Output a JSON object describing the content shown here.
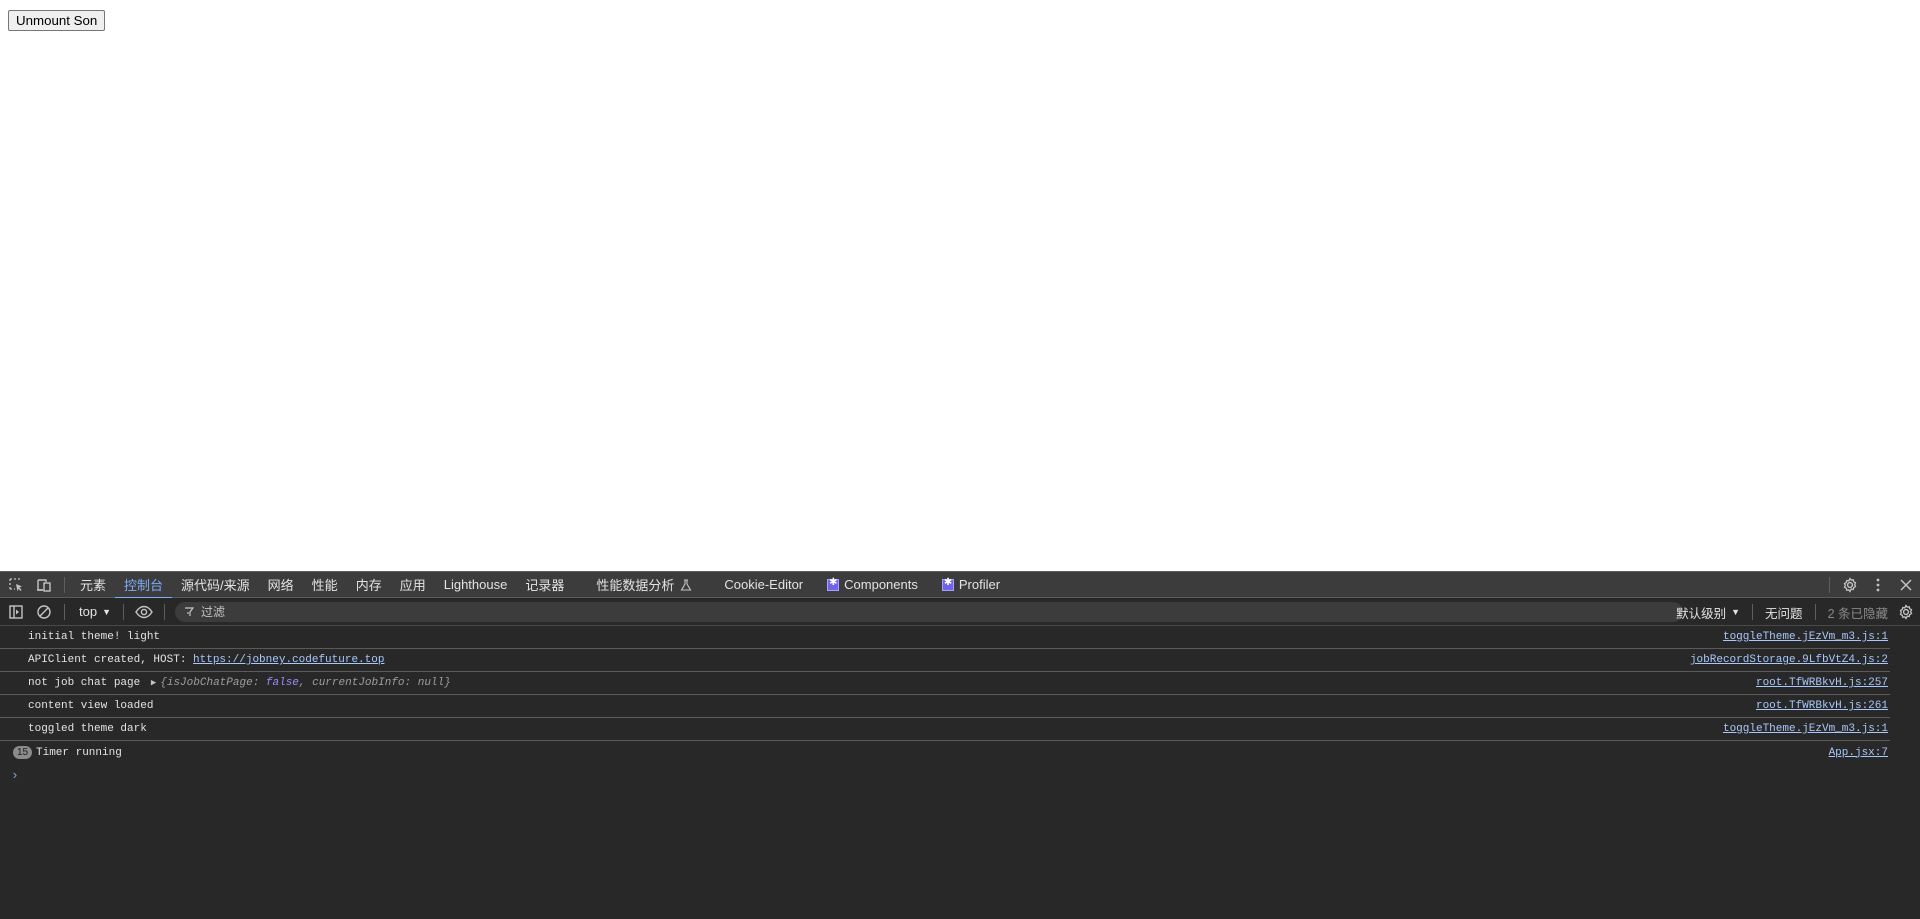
{
  "page": {
    "unmount_button": "Unmount Son"
  },
  "devtools": {
    "tabs": [
      {
        "label": "元素"
      },
      {
        "label": "控制台",
        "active": true
      },
      {
        "label": "源代码/来源"
      },
      {
        "label": "网络"
      },
      {
        "label": "性能"
      },
      {
        "label": "内存"
      },
      {
        "label": "应用"
      },
      {
        "label": "Lighthouse"
      },
      {
        "label": "记录器"
      },
      {
        "label": "性能数据分析"
      },
      {
        "label": "Cookie-Editor"
      },
      {
        "label": "Components"
      },
      {
        "label": "Profiler"
      }
    ],
    "toolbar": {
      "context": "top",
      "filter_placeholder": "过滤",
      "levels": "默认级别",
      "issues": "无问题",
      "hidden": "2 条已隐藏"
    },
    "console": [
      {
        "message": "initial theme! light",
        "source": "toggleTheme.jEzVm_m3.js:1"
      },
      {
        "message": "APIClient created, HOST: ",
        "link": "https://jobney.codefuture.top",
        "source": "jobRecordStorage.9LfbVtZ4.js:2"
      },
      {
        "message": "not job chat page ",
        "object": {
          "open": "{",
          "key1": "isJobChatPage",
          "val1": "false",
          "key2": "currentJobInfo",
          "val2": "null",
          "close": "}"
        },
        "source": "root.TfWRBkvH.js:257"
      },
      {
        "message": "content view loaded",
        "source": "root.TfWRBkvH.js:261"
      },
      {
        "message": "toggled theme dark",
        "source": "toggleTheme.jEzVm_m3.js:1"
      },
      {
        "message": "Timer running",
        "count": "15",
        "source": "App.jsx:7"
      }
    ],
    "prompt_symbol": "›"
  }
}
